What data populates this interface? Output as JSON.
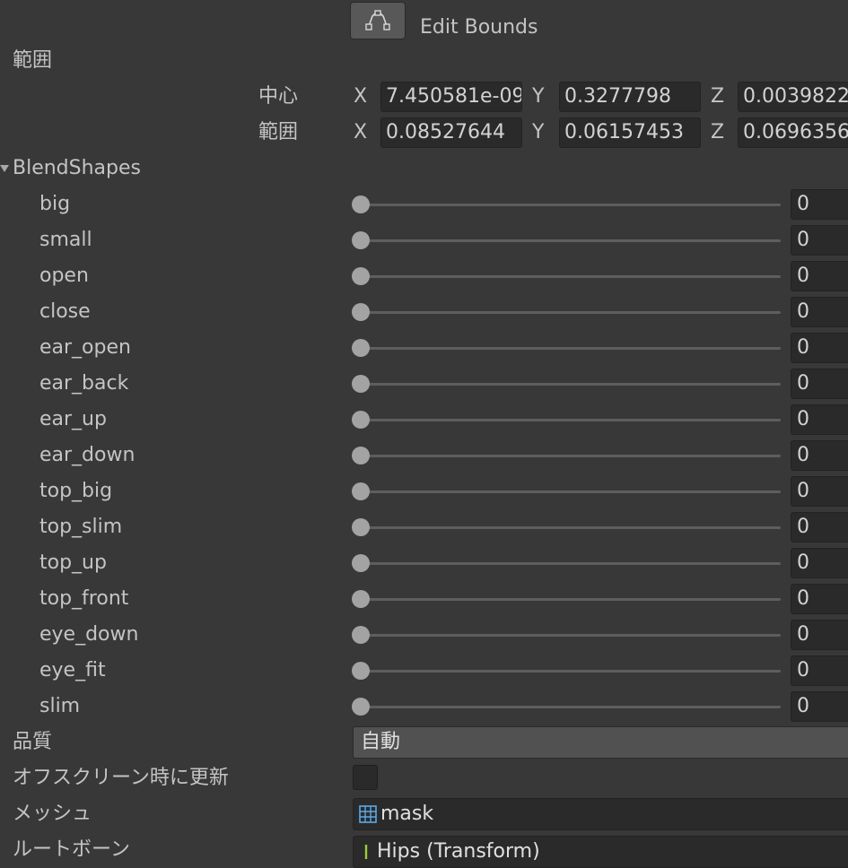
{
  "edit_bounds": {
    "label": "Edit Bounds",
    "icon": "edit-bounds-icon"
  },
  "bounds": {
    "section_label": "範囲",
    "center": {
      "label": "中心",
      "x_axis": "X",
      "x": "7.450581e-09",
      "y_axis": "Y",
      "y": "0.3277798",
      "z_axis": "Z",
      "z": "0.0039822"
    },
    "extent": {
      "label": "範囲",
      "x_axis": "X",
      "x": "0.08527644",
      "y_axis": "Y",
      "y": "0.06157453",
      "z_axis": "Z",
      "z": "0.0696356"
    }
  },
  "blendshapes": {
    "header": "BlendShapes",
    "items": [
      {
        "label": "big",
        "value": "0",
        "level": 0
      },
      {
        "label": "small",
        "value": "0",
        "level": 0
      },
      {
        "label": "open",
        "value": "0",
        "level": 0
      },
      {
        "label": "close",
        "value": "0",
        "level": 0
      },
      {
        "label": "ear_open",
        "value": "0",
        "level": 0
      },
      {
        "label": "ear_back",
        "value": "0",
        "level": 0
      },
      {
        "label": "ear_up",
        "value": "0",
        "level": 0
      },
      {
        "label": "ear_down",
        "value": "0",
        "level": 0
      },
      {
        "label": "top_big",
        "value": "0",
        "level": 0
      },
      {
        "label": "top_slim",
        "value": "0",
        "level": 0
      },
      {
        "label": "top_up",
        "value": "0",
        "level": 0
      },
      {
        "label": "top_front",
        "value": "0",
        "level": 0
      },
      {
        "label": "eye_down",
        "value": "0",
        "level": 0
      },
      {
        "label": "eye_fit",
        "value": "0",
        "level": 0
      },
      {
        "label": "slim",
        "value": "0",
        "level": 0
      }
    ]
  },
  "quality": {
    "label": "品質",
    "value": "自動"
  },
  "offscreen": {
    "label": "オフスクリーン時に更新",
    "checked": false
  },
  "mesh": {
    "label": "メッシュ",
    "value": "mask",
    "icon": "mesh-grid-icon"
  },
  "root_bone": {
    "label": "ルートボーン",
    "value": "Hips (Transform)",
    "icon": "transform-icon"
  },
  "colors": {
    "background": "#383838",
    "field": "#2a2a2a",
    "thumb": "#a3a3a3",
    "track": "#5e5e5e"
  }
}
